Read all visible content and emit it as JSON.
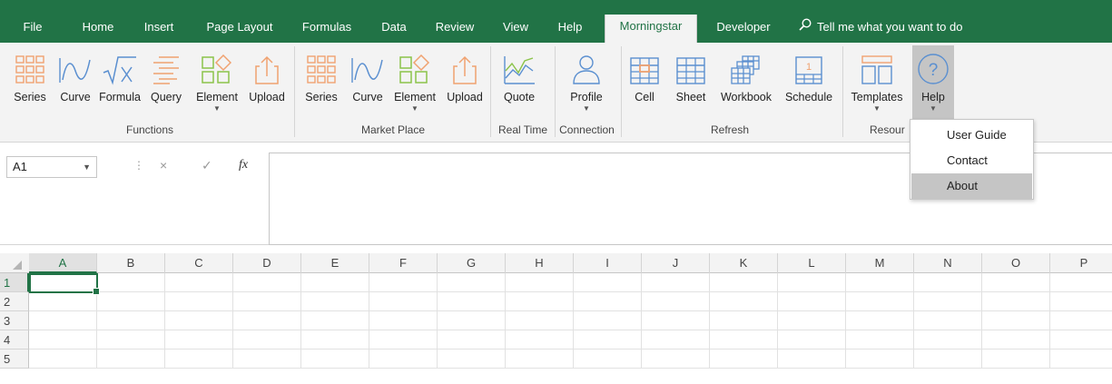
{
  "tabs": [
    {
      "label": "File"
    },
    {
      "label": "Home"
    },
    {
      "label": "Insert"
    },
    {
      "label": "Page Layout"
    },
    {
      "label": "Formulas"
    },
    {
      "label": "Data"
    },
    {
      "label": "Review"
    },
    {
      "label": "View"
    },
    {
      "label": "Help"
    },
    {
      "label": "Morningstar"
    },
    {
      "label": "Developer"
    }
  ],
  "active_tab": "Morningstar",
  "tell_me": "Tell me what you want to do",
  "ribbon": {
    "buttons": [
      {
        "label": "Series",
        "icon": "series-grid-icon"
      },
      {
        "label": "Curve",
        "icon": "curve-icon"
      },
      {
        "label": "Formula",
        "icon": "formula-icon"
      },
      {
        "label": "Query",
        "icon": "query-icon"
      },
      {
        "label": "Element",
        "icon": "element-icon"
      },
      {
        "label": "Upload",
        "icon": "upload-icon"
      },
      {
        "label": "Series",
        "icon": "series-grid-icon"
      },
      {
        "label": "Curve",
        "icon": "curve-icon"
      },
      {
        "label": "Element",
        "icon": "element-icon"
      },
      {
        "label": "Upload",
        "icon": "upload-icon"
      },
      {
        "label": "Quote",
        "icon": "quote-chart-icon"
      },
      {
        "label": "Profile",
        "icon": "profile-icon"
      },
      {
        "label": "Cell",
        "icon": "cell-table-icon"
      },
      {
        "label": "Sheet",
        "icon": "sheet-table-icon"
      },
      {
        "label": "Workbook",
        "icon": "workbook-icon"
      },
      {
        "label": "Schedule",
        "icon": "schedule-icon"
      },
      {
        "label": "Templates",
        "icon": "templates-icon"
      },
      {
        "label": "Help",
        "icon": "help-circle-icon"
      }
    ],
    "groups": [
      {
        "label": "Functions"
      },
      {
        "label": "Market Place"
      },
      {
        "label": "Real Time"
      },
      {
        "label": "Connection"
      },
      {
        "label": "Refresh"
      },
      {
        "label": "Resour"
      }
    ]
  },
  "formula_bar": {
    "name_box": "A1",
    "fx": "fx",
    "cancel": "×",
    "enter": "✓",
    "value": ""
  },
  "columns": [
    "A",
    "B",
    "C",
    "D",
    "E",
    "F",
    "G",
    "H",
    "I",
    "J",
    "K",
    "L",
    "M",
    "N",
    "O",
    "P"
  ],
  "rows": [
    "1",
    "2",
    "3",
    "4",
    "5"
  ],
  "help_menu": {
    "items": [
      {
        "label": "User Guide"
      },
      {
        "label": "Contact"
      },
      {
        "label": "About"
      }
    ],
    "highlighted": "About"
  },
  "colors": {
    "excel_green": "#217346",
    "accent_orange": "#f0a270",
    "accent_blue": "#5a8fd0"
  }
}
